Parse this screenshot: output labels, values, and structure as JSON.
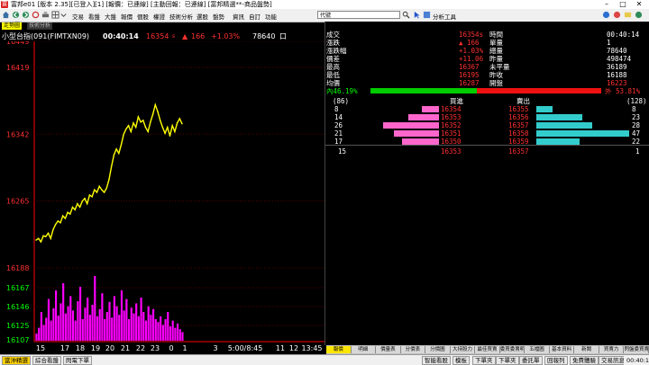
{
  "window": {
    "title": "富邦e01 [版本 2.35][已登入][1] [報價：已連線] [主動回報：已連線] [富邦精選**-商品盤勢]",
    "controls": [
      "–",
      "□",
      "✕"
    ]
  },
  "toolbar": {
    "menu": [
      "交易",
      "看盤",
      "大盤",
      "報價",
      "個股",
      "權證",
      "技術分析",
      "選股",
      "盤勢",
      "資訊",
      "自訂",
      "功能"
    ],
    "combo_value": "代號",
    "analysis_label": "分析工具"
  },
  "panel_tabs": {
    "active": "走勢圖",
    "inactive": "技術分析"
  },
  "quote_header": {
    "name": "小型台指(091(FIMTXN09)",
    "time": "00:40:14",
    "price": "16354",
    "price_suffix": "s",
    "change_arrow": "▲",
    "change": "166",
    "pct": "+1.03%",
    "volume": "78640",
    "volume_suffix": "口"
  },
  "chart_data": {
    "type": "line",
    "y_ticks": [
      16449,
      16419,
      16342,
      16265,
      16188
    ],
    "volume_ticks": [
      16167,
      16146,
      16125,
      16107
    ],
    "x_ticks": [
      "15",
      "17",
      "18",
      "19",
      "20",
      "21",
      "22",
      "23",
      "0",
      "1",
      "3",
      "5:00/8:45",
      "11",
      "12",
      "13:45"
    ],
    "reference_price": 16188,
    "ylim": [
      16188,
      16449
    ],
    "series": [
      {
        "values": [
          16220,
          16222,
          16218,
          16225,
          16224,
          16228,
          16222,
          16232,
          16238,
          16242,
          16240,
          16248,
          16245,
          16252,
          16250,
          16258,
          16255,
          16262,
          16258,
          16265,
          16268,
          16262,
          16272,
          16270,
          16278,
          16275,
          16282,
          16278,
          16275,
          16280,
          16290,
          16305,
          16318,
          16325,
          16320,
          16330,
          16342,
          16348,
          16352,
          16345,
          16355,
          16350,
          16362,
          16356,
          16358,
          16350,
          16345,
          16356,
          16365,
          16376,
          16368,
          16358,
          16350,
          16343,
          16350,
          16340,
          16352,
          16345,
          16355,
          16360,
          16354
        ]
      }
    ],
    "volume": [
      10,
      18,
      40,
      22,
      32,
      58,
      28,
      45,
      70,
      35,
      52,
      80,
      38,
      48,
      62,
      42,
      28,
      55,
      75,
      30,
      46,
      60,
      36,
      50,
      90,
      34,
      44,
      66,
      30,
      40,
      54,
      32,
      62,
      48,
      36,
      70,
      42,
      58,
      30,
      46,
      38,
      52,
      34,
      60,
      40,
      28,
      48,
      36,
      44,
      30,
      26,
      34,
      22,
      30,
      40,
      20,
      28,
      18,
      24,
      16,
      12
    ]
  },
  "quote_table": [
    {
      "l1": "成交",
      "v1": "16354s",
      "l2": "時間",
      "v2": "00:40:14"
    },
    {
      "l1": "漲跌",
      "v1": "▲ 166",
      "l2": "單量",
      "v2": "1"
    },
    {
      "l1": "漲跌幅",
      "v1": "+1.03%",
      "l2": "總量",
      "v2": "78640"
    },
    {
      "l1": "價差",
      "v1": "+11.06",
      "l2": "昨量",
      "v2": "498474"
    },
    {
      "l1": "最高",
      "v1": "16367",
      "l2": "未平量",
      "v2": "36189"
    },
    {
      "l1": "最低",
      "v1": "16195",
      "l2": "昨收",
      "v2": "16188"
    },
    {
      "l1": "均價",
      "v1": "16287",
      "l2": "開盤",
      "v2": "16223"
    }
  ],
  "ratio": {
    "inner_label": "內46.19%",
    "outer_label": "外 53.81%",
    "inner_pct": 46.19,
    "outer_pct": 53.81
  },
  "orderbook": {
    "bid_total": "(86)",
    "bid_header": "買進",
    "ask_header": "賣出",
    "ask_total": "(128)",
    "rows": [
      {
        "bid_qty": "8",
        "bid_price": "16354",
        "ask_price": "16355",
        "ask_qty": "8",
        "bid_q": 8,
        "ask_q": 8
      },
      {
        "bid_qty": "14",
        "bid_price": "16353",
        "ask_price": "16356",
        "ask_qty": "23",
        "bid_q": 14,
        "ask_q": 23
      },
      {
        "bid_qty": "26",
        "bid_price": "16352",
        "ask_price": "16357",
        "ask_qty": "28",
        "bid_q": 26,
        "ask_q": 28
      },
      {
        "bid_qty": "21",
        "bid_price": "16351",
        "ask_price": "16358",
        "ask_qty": "47",
        "bid_q": 21,
        "ask_q": 47
      },
      {
        "bid_qty": "17",
        "bid_price": "16350",
        "ask_price": "16359",
        "ask_qty": "22",
        "bid_q": 17,
        "ask_q": 22
      }
    ],
    "last_row": {
      "bid_qty": "15",
      "bid_price": "16353",
      "ask_price": "16357",
      "ask_qty": "1"
    }
  },
  "bottom_tabs": [
    "報價",
    "明細",
    "價量表",
    "分價表",
    "分價圖",
    "大持股力",
    "最佳買賣",
    "委買委賣明細",
    "五檔圖",
    "基本資料",
    "新聞",
    "買賣力",
    "閃盤委買賣"
  ],
  "status": {
    "left": [
      "當沖精選",
      "綜合看盤",
      "閃電下單"
    ],
    "middle": [
      "智能看股",
      "模板",
      "下單夾",
      "下單夾",
      "委託單",
      "回報列",
      "免費體驗"
    ],
    "right_label": "交易訊息",
    "clock": "00:40:16"
  },
  "colors": {
    "up": "#ff3030",
    "down": "#00ff00",
    "line": "#ffff00",
    "volume": "#ff00ff",
    "axis": "#ff0000",
    "bid_bar": "#ff66cc",
    "ask_bar": "#33cccc"
  }
}
